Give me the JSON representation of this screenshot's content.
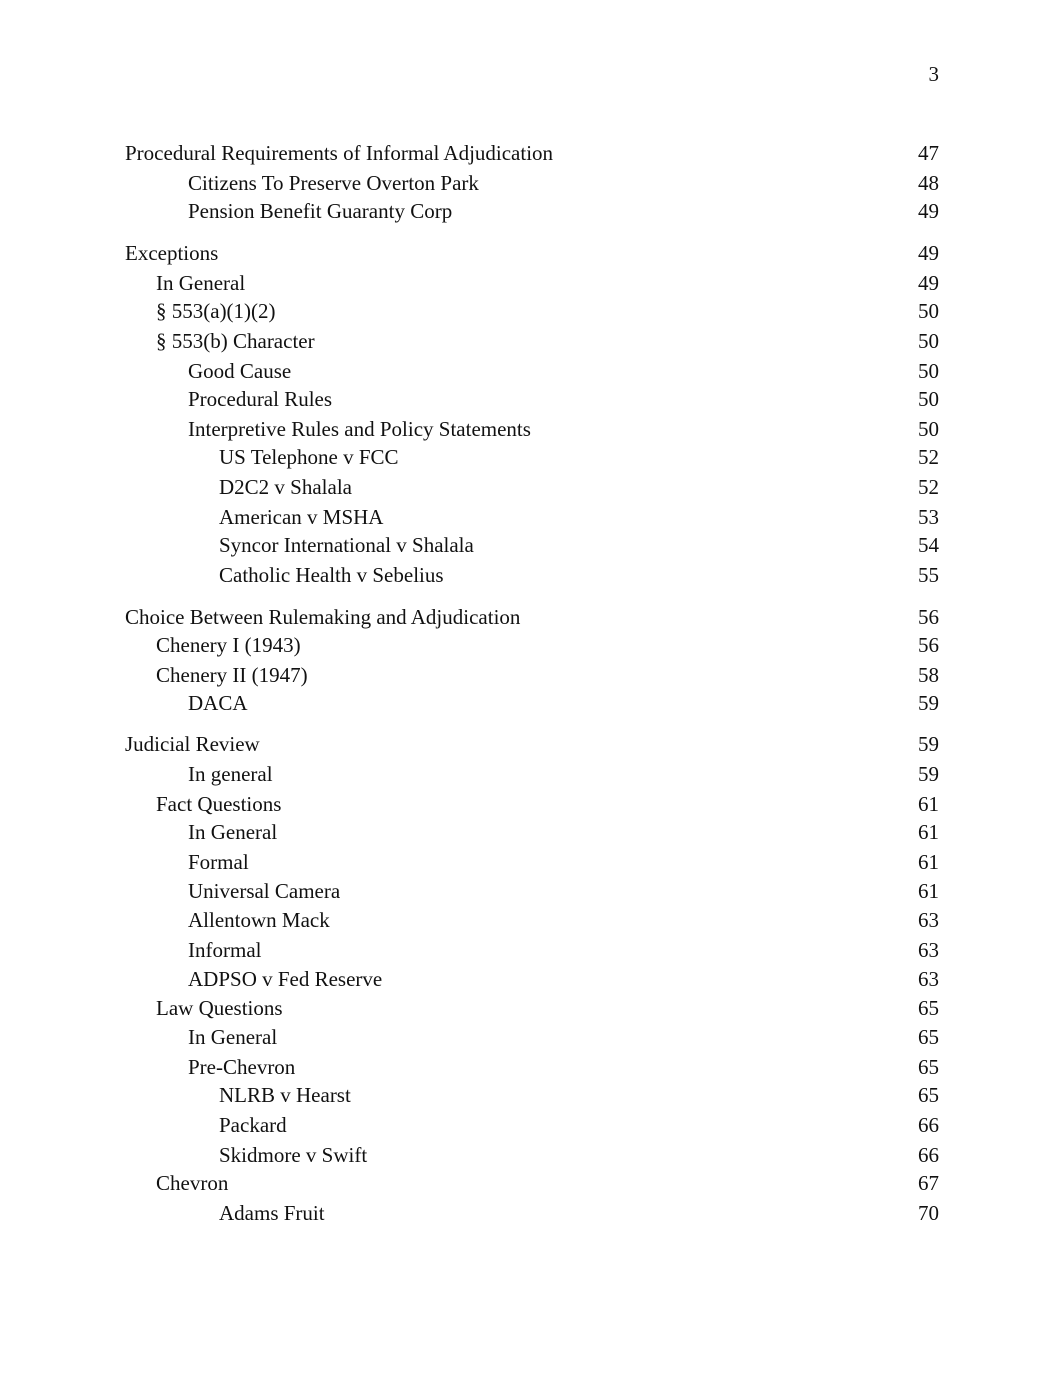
{
  "page_number": "3",
  "toc": [
    {
      "title": "Procedural Requirements of Informal Adjudication",
      "page": "47",
      "level": 0
    },
    {
      "title": "Citizens To Preserve Overton Park",
      "page": "48",
      "level": 2
    },
    {
      "title": "Pension Benefit Guaranty Corp",
      "page": "49",
      "level": 2
    },
    {
      "title": "Exceptions",
      "page": "49",
      "level": 0
    },
    {
      "title": "In General",
      "page": "49",
      "level": 1
    },
    {
      "title": "§ 553(a)(1)(2)",
      "page": "50",
      "level": 1
    },
    {
      "title": "§ 553(b) Character",
      "page": "50",
      "level": 1
    },
    {
      "title": "Good Cause",
      "page": "50",
      "level": 2
    },
    {
      "title": "Procedural Rules",
      "page": "50",
      "level": 2
    },
    {
      "title": "Interpretive Rules and Policy Statements",
      "page": "50",
      "level": 2
    },
    {
      "title": "US Telephone v FCC",
      "page": "52",
      "level": 3
    },
    {
      "title": "D2C2 v Shalala",
      "page": "52",
      "level": 3
    },
    {
      "title": "American v MSHA",
      "page": "53",
      "level": 3
    },
    {
      "title": "Syncor International v Shalala",
      "page": "54",
      "level": 3
    },
    {
      "title": "Catholic Health v Sebelius",
      "page": "55",
      "level": 3
    },
    {
      "title": "Choice Between Rulemaking and Adjudication",
      "page": "56",
      "level": 0
    },
    {
      "title": "Chenery I (1943)",
      "page": "56",
      "level": 1
    },
    {
      "title": "Chenery II (1947)",
      "page": "58",
      "level": 1
    },
    {
      "title": "DACA",
      "page": "59",
      "level": 2
    },
    {
      "title": "Judicial Review",
      "page": "59",
      "level": 0
    },
    {
      "title": "In general",
      "page": "59",
      "level": 2
    },
    {
      "title": "Fact Questions",
      "page": "61",
      "level": 1
    },
    {
      "title": "In General",
      "page": "61",
      "level": 2
    },
    {
      "title": "Formal",
      "page": "61",
      "level": 2
    },
    {
      "title": "Universal Camera",
      "page": "61",
      "level": 2
    },
    {
      "title": "Allentown Mack",
      "page": "63",
      "level": 2
    },
    {
      "title": "Informal",
      "page": "63",
      "level": 2
    },
    {
      "title": "ADPSO v Fed Reserve",
      "page": "63",
      "level": 2
    },
    {
      "title": "Law Questions",
      "page": "65",
      "level": 1
    },
    {
      "title": "In General",
      "page": "65",
      "level": 2
    },
    {
      "title": "Pre-Chevron",
      "page": "65",
      "level": 2
    },
    {
      "title": "NLRB v Hearst",
      "page": "65",
      "level": 3
    },
    {
      "title": "Packard",
      "page": "66",
      "level": 3
    },
    {
      "title": "Skidmore v Swift",
      "page": "66",
      "level": 3
    },
    {
      "title": "Chevron",
      "page": "67",
      "level": 1
    },
    {
      "title": "Adams Fruit",
      "page": "70",
      "level": 3
    }
  ]
}
